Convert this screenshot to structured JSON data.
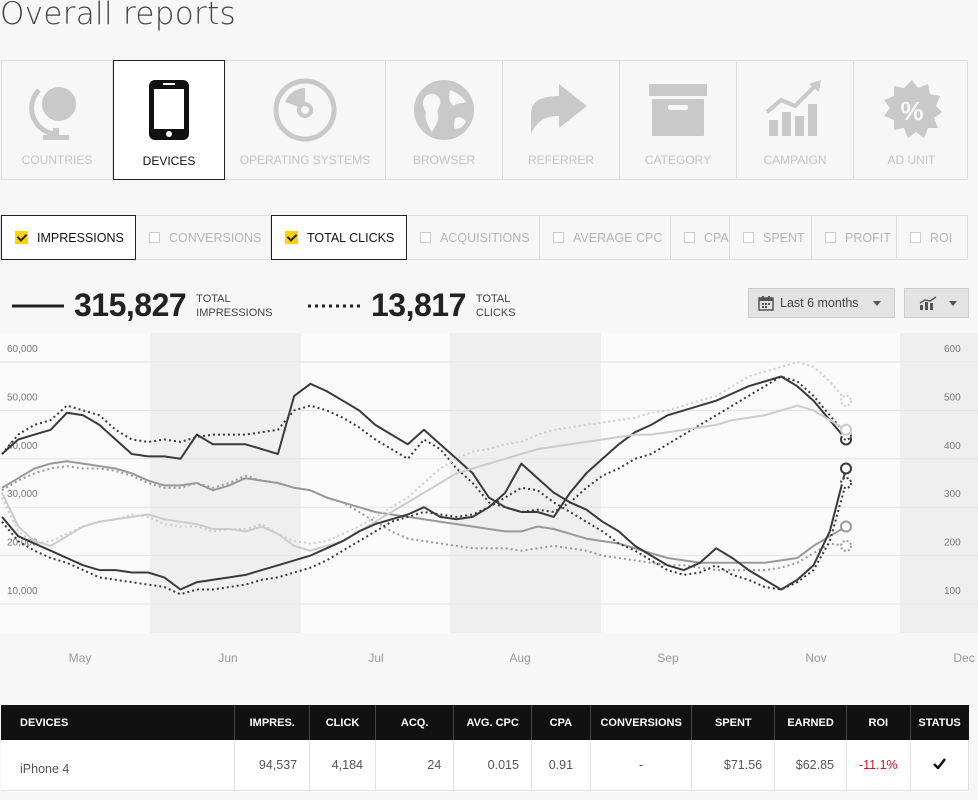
{
  "page_title": "Overall reports",
  "categories": [
    {
      "label": "COUNTRIES",
      "icon": "globe-icon",
      "active": false
    },
    {
      "label": "DEVICES",
      "icon": "smartphone-icon",
      "active": true
    },
    {
      "label": "OPERATING SYSTEMS",
      "icon": "disc-icon",
      "active": false
    },
    {
      "label": "BROWSER",
      "icon": "world-icon",
      "active": false
    },
    {
      "label": "REFERRER",
      "icon": "arrow-icon",
      "active": false
    },
    {
      "label": "CATEGORY",
      "icon": "archive-box-icon",
      "active": false
    },
    {
      "label": "CAMPAIGN",
      "icon": "growth-chart-icon",
      "active": false
    },
    {
      "label": "AD UNIT",
      "icon": "percent-badge-icon",
      "active": false
    }
  ],
  "metrics": [
    {
      "label": "IMPRESSIONS",
      "checked": true
    },
    {
      "label": "CONVERSIONS",
      "checked": false
    },
    {
      "label": "TOTAL CLICKS",
      "checked": true
    },
    {
      "label": "ACQUISITIONS",
      "checked": false
    },
    {
      "label": "AVERAGE CPC",
      "checked": false
    },
    {
      "label": "CPA",
      "checked": false
    },
    {
      "label": "SPENT",
      "checked": false
    },
    {
      "label": "PROFIT",
      "checked": false
    },
    {
      "label": "ROI",
      "checked": false
    }
  ],
  "summary": {
    "impressions": {
      "value": "315,827",
      "label_1": "TOTAL",
      "label_2": "IMPRESSIONS"
    },
    "clicks": {
      "value": "13,817",
      "label_1": "TOTAL",
      "label_2": "CLICKS"
    }
  },
  "controls": {
    "date_range": "Last 6 months",
    "chart_type_icon": "bar-chart-icon",
    "dropdown_icon": "caret-down-icon",
    "calendar_icon": "calendar-icon"
  },
  "colors": {
    "accent": "#ffd400",
    "negative": "#d0102a",
    "header_bg": "#111111"
  },
  "chart_data": {
    "type": "line",
    "x_ticks": [
      "May",
      "Jun",
      "Jul",
      "Aug",
      "Sep",
      "Nov",
      "Dec"
    ],
    "y_left": {
      "ticks": [
        "10,000",
        "20,000",
        "30,000",
        "40,000",
        "50,000",
        "60,000"
      ],
      "lim": [
        4000,
        66000
      ]
    },
    "y_right": {
      "ticks": [
        "100",
        "200",
        "300",
        "400",
        "500",
        "600"
      ],
      "lim": [
        40,
        660
      ]
    },
    "grid": true,
    "series": [
      {
        "style": "solid",
        "color": "#3a3a3a",
        "axis": "left",
        "values": [
          41000,
          44000,
          45000,
          46000,
          49500,
          49000,
          47000,
          44000,
          41000,
          40500,
          40500,
          40000,
          45000,
          43000,
          43000,
          43000,
          42000,
          41000,
          53000,
          55500,
          54000,
          52000,
          50000,
          47000,
          45000,
          43000,
          46000,
          43000,
          40000,
          37000,
          32000,
          30000,
          29000,
          29000,
          28000,
          33000,
          37000,
          40000,
          43000,
          45500,
          47000,
          49000,
          50000,
          51000,
          52000,
          53500,
          55000,
          56000,
          57000,
          55000,
          52000,
          48000,
          44000
        ]
      },
      {
        "style": "dotted",
        "color": "#3a3a3a",
        "axis": "left",
        "values": [
          41000,
          45000,
          47000,
          48000,
          51000,
          50000,
          49000,
          46000,
          44000,
          43500,
          44000,
          43500,
          44500,
          45000,
          45000,
          45000,
          45500,
          46000,
          50000,
          51000,
          50000,
          48500,
          46500,
          44000,
          42000,
          40000,
          44000,
          42000,
          38000,
          35000,
          31000,
          30000,
          29000,
          29500,
          29000,
          31000,
          34000,
          36500,
          38000,
          40000,
          41000,
          43000,
          45000,
          47000,
          49000,
          51000,
          53000,
          55000,
          57000,
          56000,
          53000,
          49000,
          45000
        ]
      },
      {
        "style": "solid",
        "color": "#999999",
        "axis": "left",
        "values": [
          34000,
          36000,
          38000,
          39000,
          39500,
          39000,
          38500,
          38000,
          37000,
          35500,
          34500,
          34500,
          35000,
          33500,
          34500,
          36000,
          35500,
          35000,
          34000,
          33500,
          32000,
          31000,
          30000,
          29000,
          28500,
          28000,
          27500,
          27000,
          26500,
          26000,
          25500,
          25000,
          25000,
          26000,
          25500,
          24500,
          23500,
          23000,
          22500,
          21500,
          20500,
          19500,
          19000,
          18500,
          18500,
          18500,
          18500,
          18500,
          19000,
          19500,
          22000,
          24000,
          26000
        ]
      },
      {
        "style": "dotted",
        "color": "#999999",
        "axis": "left",
        "values": [
          33500,
          35500,
          37000,
          38000,
          38500,
          38000,
          38000,
          37500,
          36500,
          35000,
          34000,
          34000,
          35000,
          34000,
          35000,
          36500,
          35500,
          35000,
          34000,
          33500,
          32000,
          31000,
          29000,
          27000,
          25000,
          23500,
          23000,
          22500,
          22000,
          21500,
          21500,
          21500,
          21000,
          21500,
          22000,
          21500,
          21000,
          20000,
          19500,
          19000,
          18500,
          18000,
          18000,
          17500,
          17000,
          17000,
          17000,
          17000,
          17500,
          18500,
          20500,
          22500,
          22000
        ]
      },
      {
        "style": "solid",
        "color": "#cccccc",
        "axis": "left",
        "values": [
          33000,
          26000,
          23000,
          22000,
          24000,
          26000,
          27000,
          27500,
          28000,
          28500,
          27500,
          27000,
          26500,
          25500,
          25500,
          25000,
          26000,
          24500,
          22000,
          21000,
          22000,
          23000,
          25000,
          27000,
          29000,
          31000,
          33000,
          35000,
          37000,
          38000,
          39000,
          40000,
          41000,
          42000,
          42500,
          43000,
          43500,
          44000,
          44500,
          45000,
          45000,
          45500,
          46000,
          46500,
          47000,
          48000,
          48500,
          49000,
          50000,
          51000,
          50000,
          48000,
          46000
        ]
      },
      {
        "style": "dotted",
        "color": "#cccccc",
        "axis": "left",
        "values": [
          32000,
          25000,
          22500,
          23000,
          24500,
          26000,
          27000,
          27500,
          28500,
          28000,
          26500,
          26000,
          26000,
          25000,
          25500,
          25500,
          26500,
          24500,
          23000,
          22500,
          23000,
          24500,
          26000,
          28000,
          30000,
          32000,
          35000,
          38000,
          40000,
          41500,
          42000,
          43000,
          43500,
          45000,
          46000,
          46500,
          47000,
          47500,
          48000,
          48500,
          49500,
          50000,
          51000,
          52000,
          53000,
          55000,
          57000,
          58000,
          59000,
          60000,
          59000,
          56000,
          52000
        ]
      },
      {
        "style": "solid",
        "color": "#3a3a3a",
        "axis": "left",
        "values": [
          28000,
          24000,
          22500,
          21000,
          19500,
          18000,
          17000,
          17000,
          16500,
          16500,
          15500,
          13000,
          14500,
          15000,
          15500,
          16000,
          17000,
          18000,
          19000,
          20000,
          21500,
          23000,
          25000,
          26500,
          27500,
          28500,
          30000,
          28000,
          27500,
          28000,
          30000,
          33000,
          39000,
          36000,
          33000,
          31000,
          29500,
          27000,
          25000,
          22000,
          20000,
          18000,
          17000,
          18500,
          21500,
          19500,
          17000,
          15000,
          13000,
          15000,
          18000,
          25000,
          38000
        ]
      },
      {
        "style": "dotted",
        "color": "#3a3a3a",
        "axis": "left",
        "values": [
          27000,
          23000,
          21000,
          19500,
          18500,
          17000,
          15500,
          15000,
          14500,
          14000,
          13500,
          12000,
          13000,
          13000,
          13500,
          14000,
          15000,
          15500,
          16500,
          17500,
          19000,
          21000,
          23000,
          25000,
          27000,
          28000,
          29000,
          28500,
          28000,
          28500,
          30000,
          32000,
          34000,
          33500,
          31000,
          29000,
          27000,
          25000,
          22500,
          21000,
          19000,
          17000,
          16000,
          16500,
          18000,
          16000,
          15000,
          13500,
          13000,
          14500,
          17000,
          23000,
          35000
        ]
      }
    ]
  },
  "table": {
    "columns": [
      "DEVICES",
      "IMPRES.",
      "CLICK",
      "ACQ.",
      "AVG. CPC",
      "CPA",
      "CONVERSIONS",
      "SPENT",
      "EARNED",
      "ROI",
      "STATUS"
    ],
    "rows": [
      {
        "device": "iPhone 4",
        "impressions": "94,537",
        "clicks": "4,184",
        "acq": "24",
        "avg_cpc": "0.015",
        "cpa": "0.91",
        "conversions": "-",
        "spent": "$71.56",
        "earned": "$62.85",
        "roi": "-11.1%",
        "status_icon": "checkmark-icon"
      }
    ]
  }
}
